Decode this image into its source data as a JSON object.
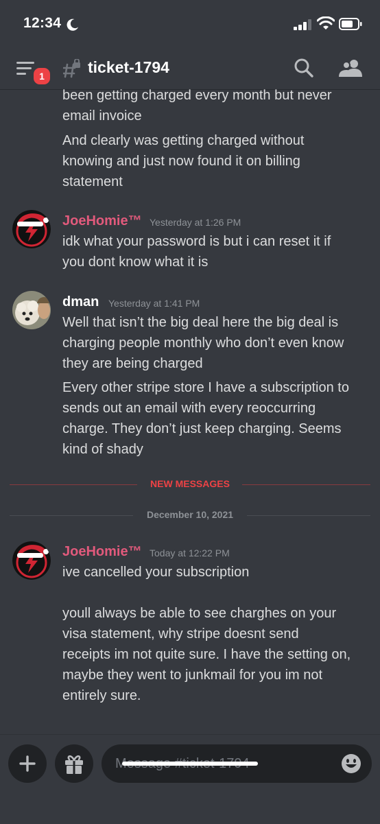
{
  "status_bar": {
    "time": "12:34"
  },
  "header": {
    "badge_count": "1",
    "channel_name": "ticket-1794"
  },
  "messages": {
    "top_lines": [
      "been getting charged every month but never\nemail invoice",
      "And clearly was getting charged without\nknowing and just now found it on billing\nstatement"
    ],
    "msg1": {
      "author": "JoeHomie™",
      "timestamp": "Yesterday at 1:26 PM",
      "text": "idk what your password is but i can reset it if\nyou dont know what it is"
    },
    "msg2": {
      "author": "dman",
      "timestamp": "Yesterday at 1:41 PM",
      "text1": "Well that isn’t the big deal here the big deal is\ncharging people monthly who don’t even know\nthey are being charged",
      "text2": "Every other stripe store I have a subscription to\nsends out an email with every reoccurring\ncharge. They don’t just keep charging. Seems\nkind of shady"
    },
    "new_messages_label": "NEW MESSAGES",
    "date_divider": "December 10, 2021",
    "msg3": {
      "author": "JoeHomie™",
      "timestamp": "Today at 12:22 PM",
      "text1": "ive cancelled your subscription",
      "text2": "youll always be able to see charghes on your\nvisa statement, why stripe doesnt send\nreceipts im not quite sure. I have the setting on,\nmaybe they went to junkmail for you im not\nentirely sure."
    }
  },
  "composer": {
    "placeholder": "Message #ticket-1794"
  },
  "icons": {
    "moon": "moon-icon",
    "signal": "cellular-signal-icon",
    "wifi": "wifi-icon",
    "battery": "battery-icon",
    "menu": "hamburger-menu-icon",
    "channel": "locked-text-channel-icon",
    "search": "search-icon",
    "members": "members-icon",
    "add": "plus-icon",
    "gift": "gift-icon",
    "emoji": "emoji-icon"
  },
  "colors": {
    "background": "#36393f",
    "input_background": "#202225",
    "username_red": "#e25a7c",
    "new_messages_red": "#ed4245",
    "muted": "#8e9297",
    "message_text": "#dcddde"
  }
}
